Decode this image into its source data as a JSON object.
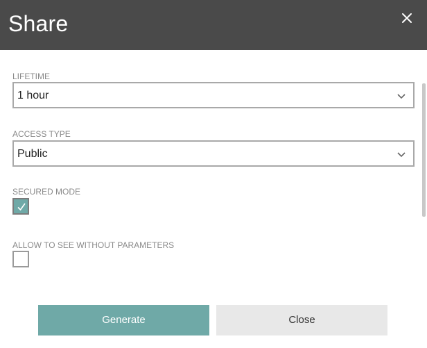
{
  "dialog": {
    "title": "Share",
    "close_icon": "close-icon"
  },
  "fields": {
    "lifetime": {
      "label": "LIFETIME",
      "value": "1 hour"
    },
    "access_type": {
      "label": "ACCESS TYPE",
      "value": "Public"
    },
    "secured_mode": {
      "label": "SECURED MODE",
      "checked": true
    },
    "allow_without_params": {
      "label": "ALLOW TO SEE WITHOUT PARAMETERS",
      "checked": false
    }
  },
  "buttons": {
    "generate": "Generate",
    "close": "Close"
  },
  "colors": {
    "header_bg": "#4a4a4a",
    "accent": "#6fa9a7",
    "secondary_bg": "#e8e8e8"
  }
}
